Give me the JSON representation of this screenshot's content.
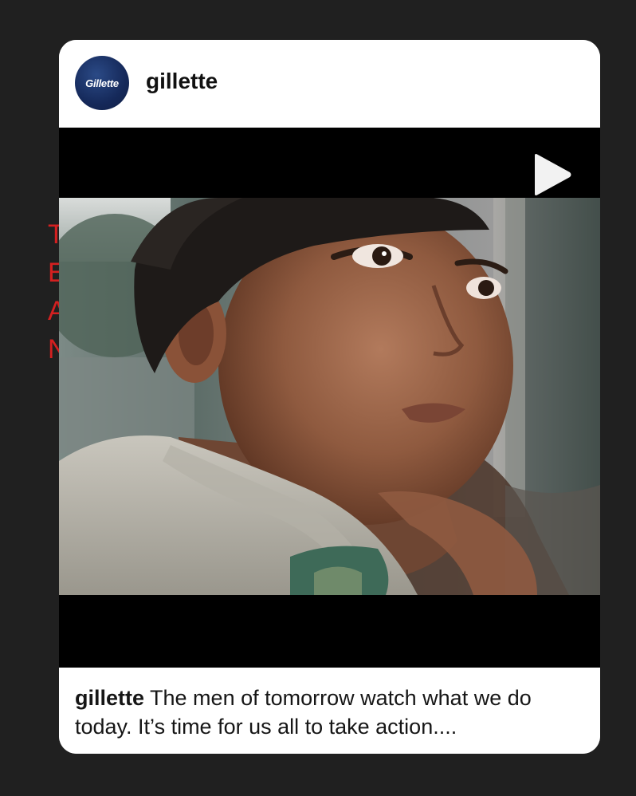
{
  "background_letters": [
    "T",
    "E",
    "A",
    "N"
  ],
  "post": {
    "avatar_logo_text": "Gillette",
    "username": "gillette",
    "media": {
      "type": "video",
      "play_icon": "play-icon"
    },
    "caption": {
      "username": "gillette",
      "text": " The men of tomorrow watch what we do today. It’s time for us all to take action...."
    }
  },
  "colors": {
    "page_background": "#202020",
    "card_background": "#ffffff",
    "avatar_navy": "#15295a",
    "letter_red": "#d42020"
  }
}
